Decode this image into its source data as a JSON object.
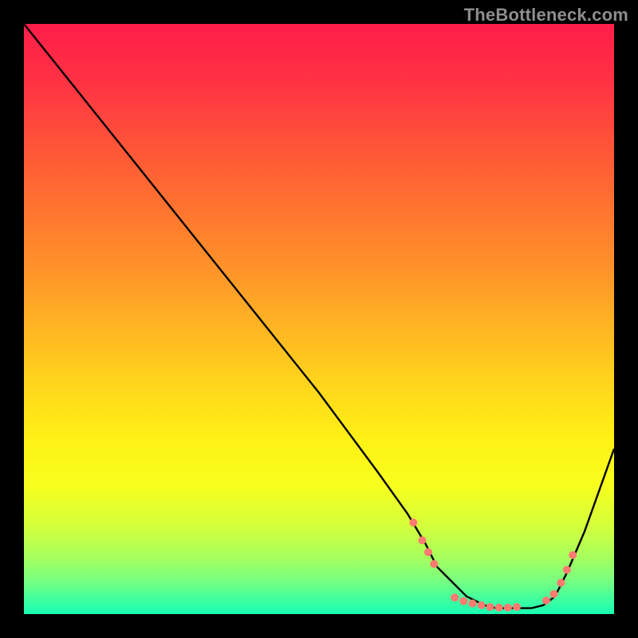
{
  "watermark": "TheBottleneck.com",
  "gradient_stops": [
    {
      "offset": 0.0,
      "color": "#ff1d49"
    },
    {
      "offset": 0.1,
      "color": "#ff3344"
    },
    {
      "offset": 0.2,
      "color": "#ff5238"
    },
    {
      "offset": 0.3,
      "color": "#ff7030"
    },
    {
      "offset": 0.4,
      "color": "#ff8e2a"
    },
    {
      "offset": 0.5,
      "color": "#ffb024"
    },
    {
      "offset": 0.6,
      "color": "#ffd21c"
    },
    {
      "offset": 0.7,
      "color": "#fff015"
    },
    {
      "offset": 0.78,
      "color": "#f8ff1d"
    },
    {
      "offset": 0.85,
      "color": "#d4ff3b"
    },
    {
      "offset": 0.9,
      "color": "#aaff5a"
    },
    {
      "offset": 0.94,
      "color": "#7dff7d"
    },
    {
      "offset": 0.97,
      "color": "#48ff9a"
    },
    {
      "offset": 1.0,
      "color": "#18ffb3"
    }
  ],
  "chart_data": {
    "type": "line",
    "title": "",
    "xlabel": "",
    "ylabel": "",
    "xlim": [
      0,
      100
    ],
    "ylim": [
      0,
      100
    ],
    "series": [
      {
        "name": "curve",
        "x": [
          0,
          4,
          10,
          20,
          30,
          40,
          50,
          60,
          65,
          68,
          70,
          73,
          75,
          78,
          80,
          83,
          86,
          88,
          90,
          92,
          95,
          100
        ],
        "y": [
          100,
          95,
          87.5,
          75,
          62.5,
          50,
          37.5,
          24,
          17,
          12,
          8,
          5,
          3,
          1.5,
          1,
          1,
          1,
          1.5,
          3,
          7,
          14,
          28
        ]
      }
    ],
    "markers": [
      {
        "x": 66,
        "y": 15.5
      },
      {
        "x": 67.5,
        "y": 12.5
      },
      {
        "x": 68.5,
        "y": 10.5
      },
      {
        "x": 69.5,
        "y": 8.5
      },
      {
        "x": 73,
        "y": 2.8
      },
      {
        "x": 74.5,
        "y": 2.2
      },
      {
        "x": 76,
        "y": 1.8
      },
      {
        "x": 77.5,
        "y": 1.5
      },
      {
        "x": 79,
        "y": 1.2
      },
      {
        "x": 80.5,
        "y": 1.1
      },
      {
        "x": 82,
        "y": 1.1
      },
      {
        "x": 83.5,
        "y": 1.2
      },
      {
        "x": 88.5,
        "y": 2.3
      },
      {
        "x": 89.8,
        "y": 3.4
      },
      {
        "x": 91,
        "y": 5.3
      },
      {
        "x": 92,
        "y": 7.5
      },
      {
        "x": 93,
        "y": 10
      }
    ],
    "marker_color": "#ff7a70",
    "marker_radius": 5
  }
}
